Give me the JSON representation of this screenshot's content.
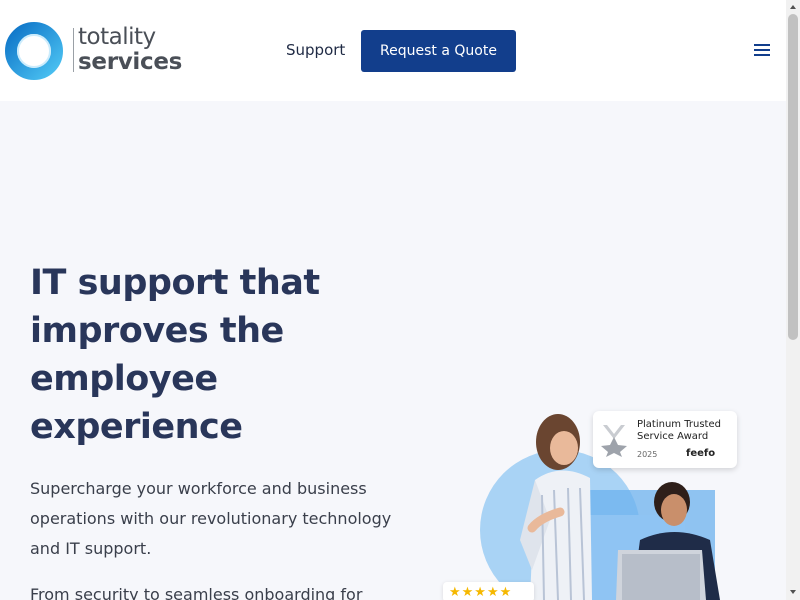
{
  "brand": {
    "name_line1": "totality",
    "name_line2": "services",
    "ring_color": "#1e9ae0"
  },
  "header": {
    "support_label": "Support",
    "quote_label": "Request a Quote",
    "menu_icon": "hamburger-menu-icon"
  },
  "hero": {
    "title": "IT support that improves the employee experience",
    "subtitle": "Supercharge your workforce and business operations with our revolutionary technology and IT support.",
    "subtitle2": "From security to seamless onboarding for"
  },
  "award": {
    "line1": "Platinum Trusted",
    "line2": "Service Award",
    "year": "2025",
    "brand": "feefo"
  },
  "rating": {
    "stars": 5,
    "stars_text": "★★★★★"
  },
  "colors": {
    "primary": "#123e8c",
    "heading": "#29365a",
    "hero_bg": "#f6f7fb"
  }
}
